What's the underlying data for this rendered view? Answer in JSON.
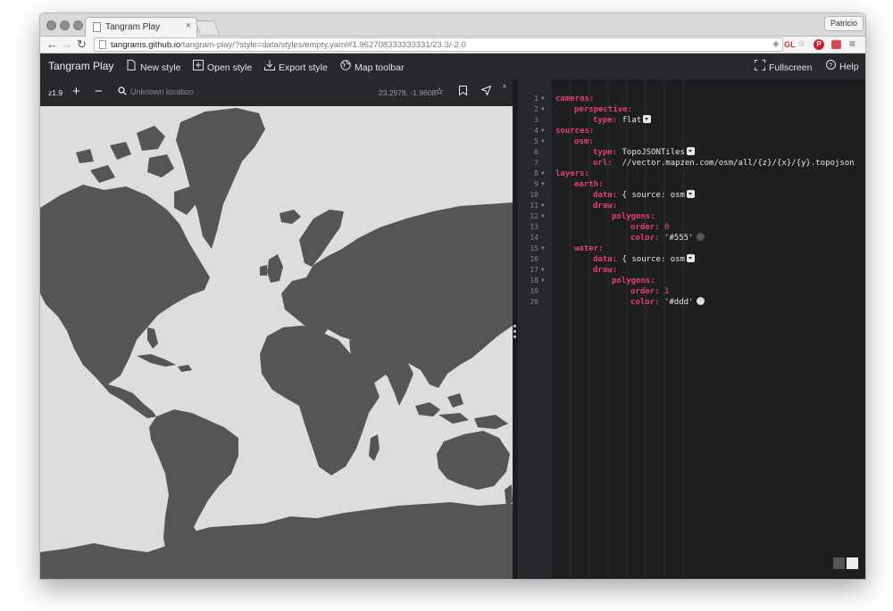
{
  "browser": {
    "tab_title": "Tangram Play",
    "tab_close": "×",
    "profile_name": "Patricio",
    "url_host": "tangrams.github.io",
    "url_rest": "/tangram-play/?style=data/styles/empty.yaml#1.962708333333331/23.3/-2.0",
    "ext_gl_label": "GL"
  },
  "toolbar": {
    "brand": "Tangram Play",
    "new_style": "New style",
    "open_style": "Open style",
    "export_style": "Export style",
    "map_toolbar": "Map toolbar",
    "fullscreen": "Fullscreen",
    "help": "Help"
  },
  "map": {
    "zoom_level": "z1.9",
    "zoom_in": "+",
    "zoom_out": "−",
    "search_placeholder": "Unknown location",
    "coordinates": "23.2978, -1.9608",
    "water_color": "#dddddd",
    "land_color": "#555555"
  },
  "editor": {
    "lines": [
      {
        "n": "1",
        "fold": true,
        "indent": 0,
        "parts": [
          {
            "t": "cameras:",
            "c": "k"
          }
        ]
      },
      {
        "n": "2",
        "fold": true,
        "indent": 1,
        "parts": [
          {
            "t": "perspective:",
            "c": "k"
          }
        ]
      },
      {
        "n": "3",
        "fold": false,
        "indent": 2,
        "parts": [
          {
            "t": "type: ",
            "c": "k"
          },
          {
            "t": "flat",
            "c": "v"
          }
        ],
        "dropdown": true
      },
      {
        "n": "4",
        "fold": true,
        "indent": 0,
        "parts": [
          {
            "t": "sources:",
            "c": "k"
          }
        ]
      },
      {
        "n": "5",
        "fold": true,
        "indent": 1,
        "parts": [
          {
            "t": "osm:",
            "c": "k"
          }
        ]
      },
      {
        "n": "6",
        "fold": false,
        "indent": 2,
        "parts": [
          {
            "t": "type: ",
            "c": "k"
          },
          {
            "t": "TopoJSONTiles",
            "c": "v"
          }
        ],
        "dropdown": true
      },
      {
        "n": "7",
        "fold": false,
        "indent": 2,
        "parts": [
          {
            "t": "url:  ",
            "c": "k"
          },
          {
            "t": "//vector.mapzen.com/osm/all/{z}/{x}/{y}.topojson",
            "c": "v"
          }
        ]
      },
      {
        "n": "8",
        "fold": true,
        "indent": 0,
        "parts": [
          {
            "t": "layers:",
            "c": "k"
          }
        ]
      },
      {
        "n": "9",
        "fold": true,
        "indent": 1,
        "parts": [
          {
            "t": "earth:",
            "c": "k"
          }
        ]
      },
      {
        "n": "10",
        "fold": false,
        "indent": 2,
        "parts": [
          {
            "t": "data: ",
            "c": "k"
          },
          {
            "t": "{ source: osm",
            "c": "v"
          }
        ],
        "dropdown": true
      },
      {
        "n": "11",
        "fold": true,
        "indent": 2,
        "parts": [
          {
            "t": "draw:",
            "c": "k"
          }
        ]
      },
      {
        "n": "12",
        "fold": true,
        "indent": 3,
        "parts": [
          {
            "t": "polygons:",
            "c": "k"
          }
        ]
      },
      {
        "n": "13",
        "fold": false,
        "indent": 4,
        "parts": [
          {
            "t": "order: ",
            "c": "k"
          },
          {
            "t": "0",
            "c": "n"
          }
        ]
      },
      {
        "n": "14",
        "fold": false,
        "indent": 4,
        "parts": [
          {
            "t": "color: ",
            "c": "k"
          },
          {
            "t": "'#555'",
            "c": "s"
          }
        ],
        "swatch": "#555555"
      },
      {
        "n": "15",
        "fold": true,
        "indent": 1,
        "parts": [
          {
            "t": "water:",
            "c": "k"
          }
        ]
      },
      {
        "n": "16",
        "fold": false,
        "indent": 2,
        "parts": [
          {
            "t": "data: ",
            "c": "k"
          },
          {
            "t": "{ source: osm",
            "c": "v"
          }
        ],
        "dropdown": true
      },
      {
        "n": "17",
        "fold": true,
        "indent": 2,
        "parts": [
          {
            "t": "draw:",
            "c": "k"
          }
        ]
      },
      {
        "n": "18",
        "fold": true,
        "indent": 3,
        "parts": [
          {
            "t": "polygons:",
            "c": "k"
          }
        ]
      },
      {
        "n": "19",
        "fold": false,
        "indent": 4,
        "parts": [
          {
            "t": "order: ",
            "c": "k"
          },
          {
            "t": "1",
            "c": "n"
          }
        ]
      },
      {
        "n": "20",
        "fold": false,
        "indent": 4,
        "parts": [
          {
            "t": "color: ",
            "c": "k"
          },
          {
            "t": "'#ddd'",
            "c": "s"
          }
        ],
        "swatch": "#dddddd"
      }
    ],
    "theme_swatches": [
      "#555555",
      "#eeeeee"
    ]
  }
}
